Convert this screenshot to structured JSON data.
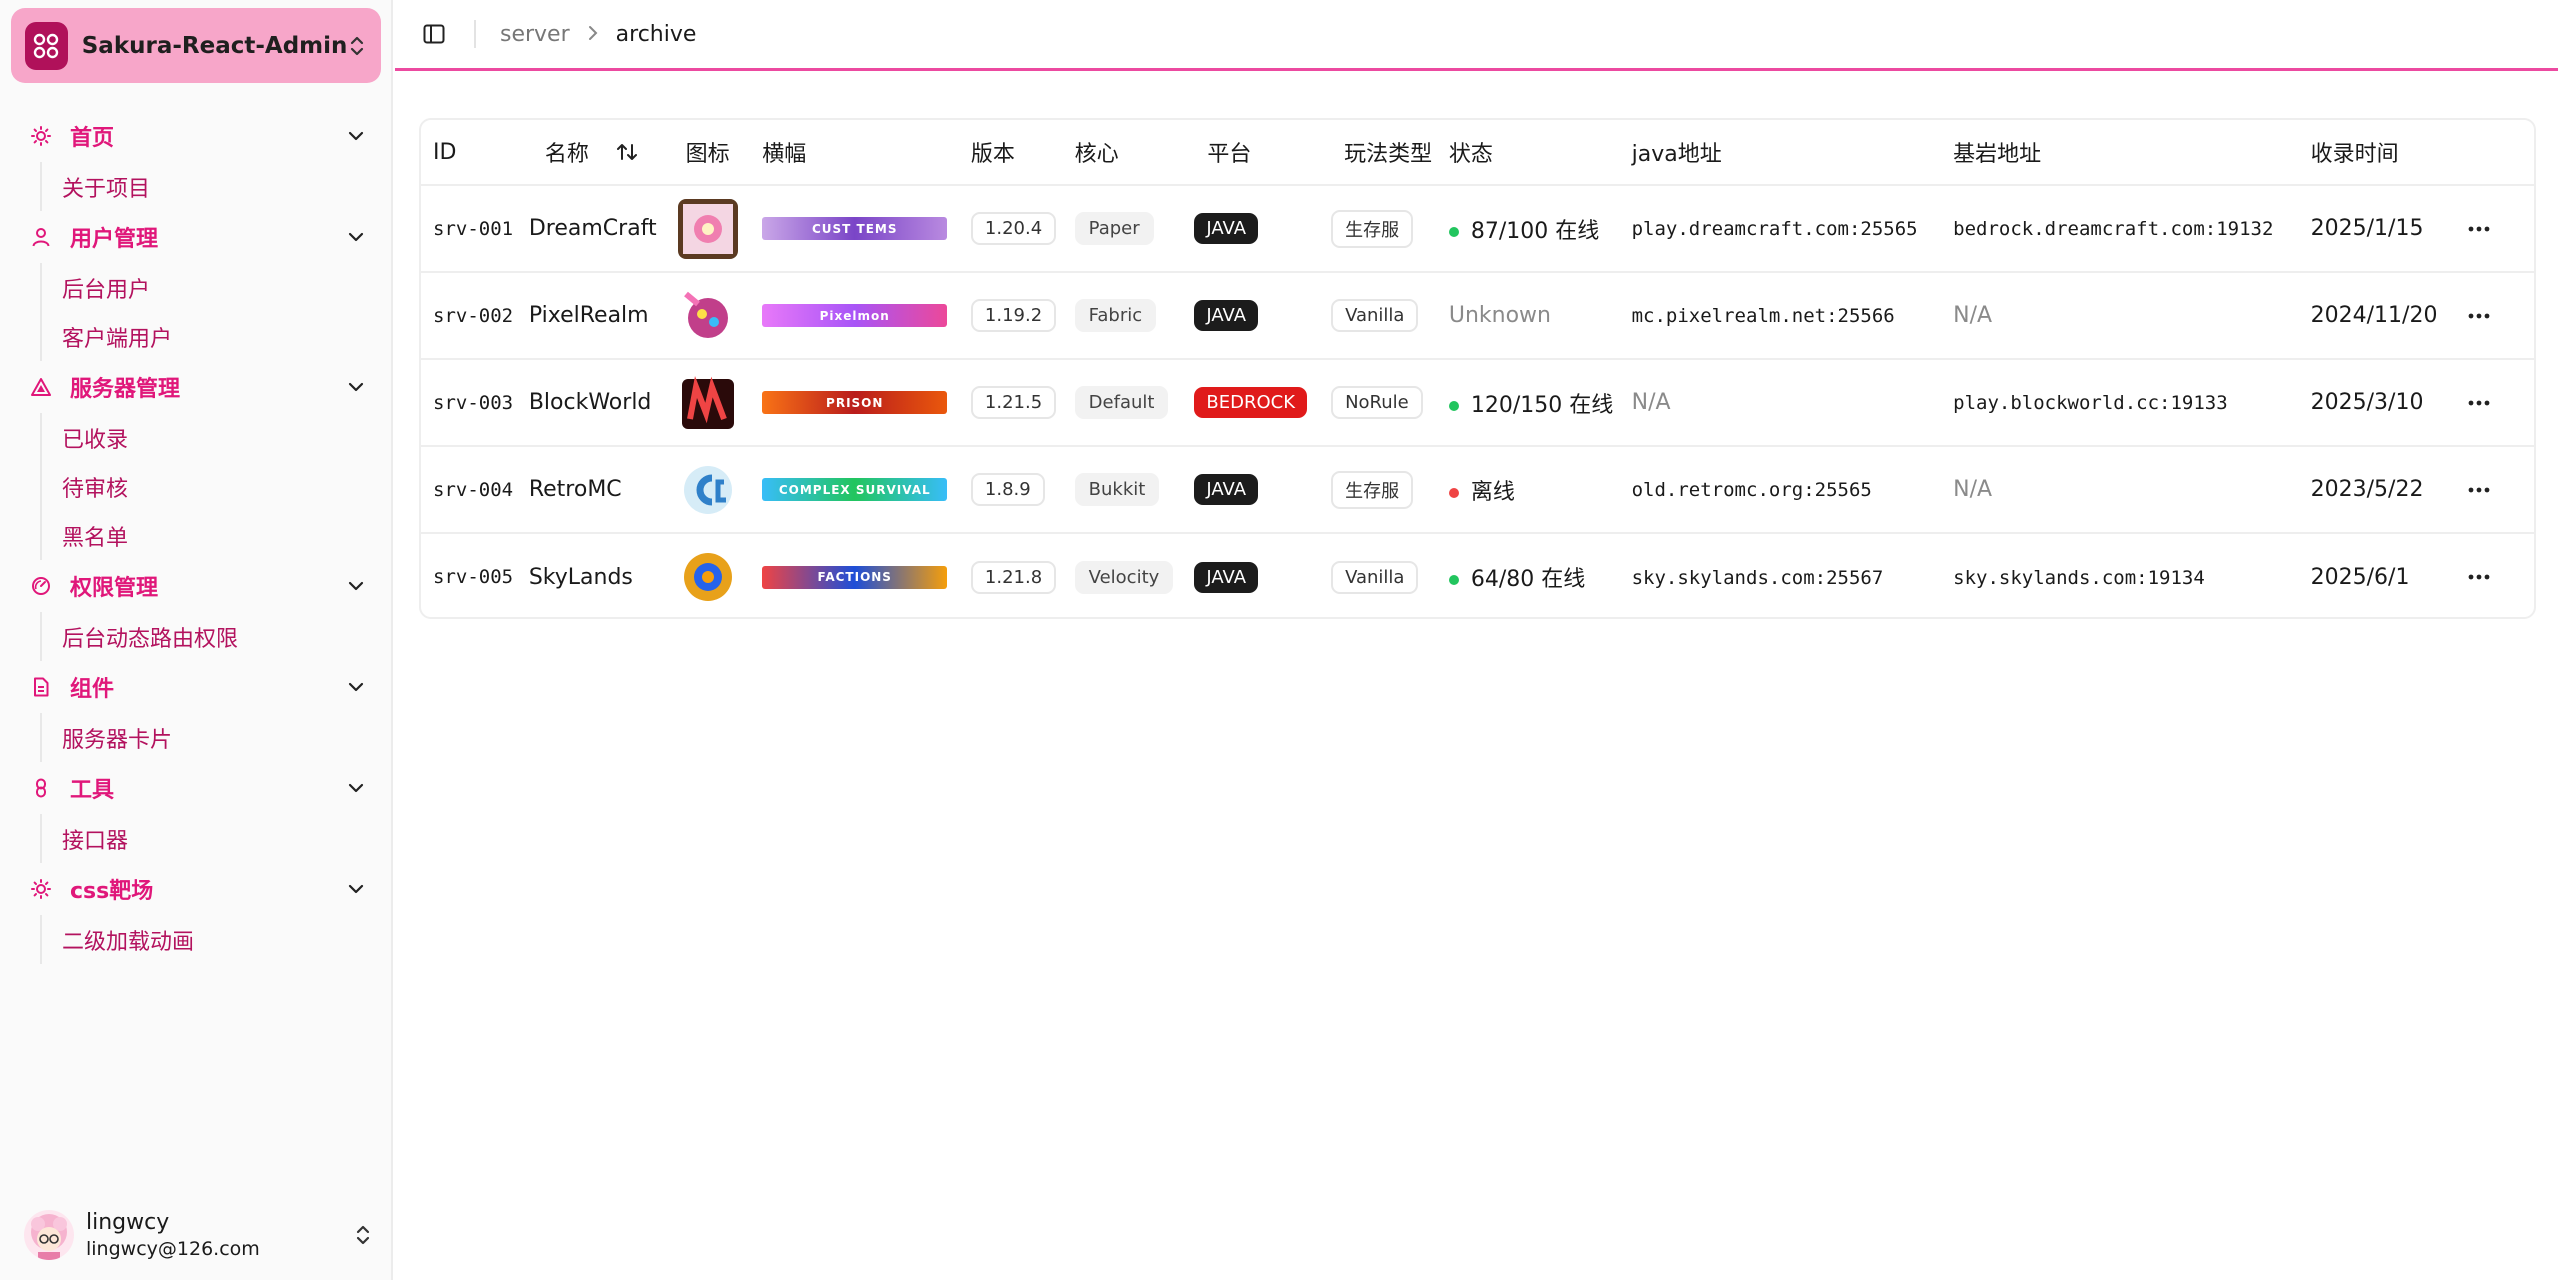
{
  "brand": {
    "title": "Sakura-React-Admin",
    "accent": "#e0177a"
  },
  "nav": [
    {
      "label": "首页",
      "icon": "sun-icon",
      "items": [
        "关于项目"
      ]
    },
    {
      "label": "用户管理",
      "icon": "user-icon",
      "items": [
        "后台用户",
        "客户端用户"
      ]
    },
    {
      "label": "服务器管理",
      "icon": "triangle-icon",
      "items": [
        "已收录",
        "待审核",
        "黑名单"
      ]
    },
    {
      "label": "权限管理",
      "icon": "gauge-icon",
      "items": [
        "后台动态路由权限"
      ]
    },
    {
      "label": "组件",
      "icon": "file-icon",
      "items": [
        "服务器卡片"
      ]
    },
    {
      "label": "工具",
      "icon": "link-icon",
      "items": [
        "接口器"
      ]
    },
    {
      "label": "css靶场",
      "icon": "sun-icon",
      "items": [
        "二级加载动画"
      ]
    }
  ],
  "user": {
    "name": "lingwcy",
    "email": "lingwcy@126.com"
  },
  "breadcrumb": {
    "parent": "server",
    "current": "archive"
  },
  "table": {
    "headers": {
      "id": "ID",
      "name": "名称",
      "icon": "图标",
      "banner": "横幅",
      "version": "版本",
      "core": "核心",
      "platform": "平台",
      "mode": "玩法类型",
      "status": "状态",
      "java": "java地址",
      "bedrock": "基岩地址",
      "date": "收录时间"
    },
    "rows": [
      {
        "id": "srv-001",
        "name": "DreamCraft",
        "version": "1.20.4",
        "core": "Paper",
        "platform": "JAVA",
        "mode": "生存服",
        "status": "87/100 在线",
        "status_color": "#22c55e",
        "java": "play.dreamcraft.com:25565",
        "bedrock": "bedrock.dreamcraft.com:19132",
        "date": "2025/1/15",
        "banner_text": "CUST   TEMS"
      },
      {
        "id": "srv-002",
        "name": "PixelRealm",
        "version": "1.19.2",
        "core": "Fabric",
        "platform": "JAVA",
        "mode": "Vanilla",
        "status": "Unknown",
        "status_color": "",
        "java": "mc.pixelrealm.net:25566",
        "bedrock": "N/A",
        "date": "2024/11/20",
        "banner_text": "Pixelmon"
      },
      {
        "id": "srv-003",
        "name": "BlockWorld",
        "version": "1.21.5",
        "core": "Default",
        "platform": "BEDROCK",
        "mode": "NoRule",
        "status": "120/150 在线",
        "status_color": "#22c55e",
        "java": "N/A",
        "bedrock": "play.blockworld.cc:19133",
        "date": "2025/3/10",
        "banner_text": "PRISON"
      },
      {
        "id": "srv-004",
        "name": "RetroMC",
        "version": "1.8.9",
        "core": "Bukkit",
        "platform": "JAVA",
        "mode": "生存服",
        "status": "离线",
        "status_color": "#ef4444",
        "java": "old.retromc.org:25565",
        "bedrock": "N/A",
        "date": "2023/5/22",
        "banner_text": "COMPLEX  SURVIVAL"
      },
      {
        "id": "srv-005",
        "name": "SkyLands",
        "version": "1.21.8",
        "core": "Velocity",
        "platform": "JAVA",
        "mode": "Vanilla",
        "status": "64/80 在线",
        "status_color": "#22c55e",
        "java": "sky.skylands.com:25567",
        "bedrock": "sky.skylands.com:19134",
        "date": "2025/6/1",
        "banner_text": "FACTIONS"
      }
    ]
  }
}
